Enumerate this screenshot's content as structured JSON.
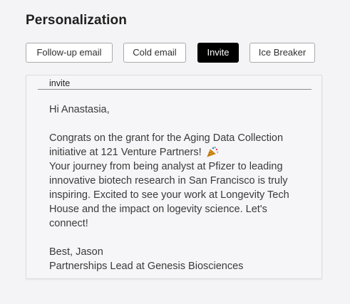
{
  "page": {
    "title": "Personalization"
  },
  "tabs": [
    {
      "label": "Follow-up email",
      "active": false
    },
    {
      "label": "Cold email",
      "active": false
    },
    {
      "label": "Invite",
      "active": true
    },
    {
      "label": "Ice Breaker",
      "active": false
    }
  ],
  "editor": {
    "tab_label": "invite",
    "greeting": "Hi Anastasia,",
    "body_main": "Congrats on the grant for the Aging Data Collection initiative at 121 Venture Partners! ",
    "body_emoji": "party-popper-icon",
    "body_rest": "\nYour journey from being analyst at Pfizer to leading innovative biotech research in San Francisco is truly inspiring. Excited to see your work at Longevity Tech House and the impact on logevity science. Let's connect!",
    "signoff": "Best, Jason",
    "signature": "Partnerships Lead at Genesis Biosciences"
  },
  "colors": {
    "active_tab_bg": "#000000",
    "active_tab_text": "#ffffff",
    "tab_border": "#a9a9a9",
    "page_bg": "#f4f4f6"
  }
}
